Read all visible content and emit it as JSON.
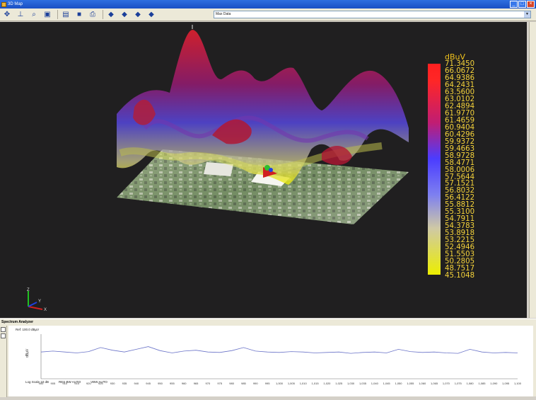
{
  "window": {
    "title": "3D Map",
    "min": "_",
    "max": "□",
    "close": "×"
  },
  "toolbar": {
    "buttons": [
      "move-icon",
      "axis-icon",
      "zoom-icon",
      "fit-icon",
      "export-icon",
      "save-icon",
      "print-icon",
      "view-front-icon",
      "view-top-icon",
      "view-iso-icon",
      "view-side-icon"
    ],
    "dropdown_value": "Max Data",
    "dropdown_arrow": "▼"
  },
  "legend": {
    "unit": "dBuV",
    "values": [
      "71.3450",
      "66.0672",
      "64.9386",
      "64.2431",
      "63.5600",
      "63.0102",
      "62.4894",
      "61.9770",
      "61.4659",
      "60.9404",
      "60.4296",
      "59.9372",
      "59.4663",
      "58.9728",
      "58.4771",
      "58.0006",
      "57.5644",
      "57.1521",
      "56.8032",
      "56.4122",
      "55.8812",
      "55.3100",
      "54.7911",
      "54.3783",
      "53.8918",
      "53.2215",
      "52.4946",
      "51.5503",
      "50.2805",
      "48.7517",
      "45.1048"
    ]
  },
  "axes": {
    "z": "Z",
    "y": "Y",
    "x": "X"
  },
  "spectrum": {
    "title": "Spectrum Analyzer",
    "ref_level": "Ref: 100.0 dBµV",
    "ylabel": "dBµV",
    "xticks": [
      "900",
      "905",
      "910",
      "915",
      "920",
      "925",
      "930",
      "935",
      "940",
      "945",
      "950",
      "955",
      "960",
      "965",
      "970",
      "975",
      "980",
      "985",
      "990",
      "995",
      "1,000",
      "1,005",
      "1,010",
      "1,015",
      "1,020",
      "1,025",
      "1,030",
      "1,035",
      "1,040",
      "1,045",
      "1,050",
      "1,055",
      "1,060",
      "1,065",
      "1,070",
      "1,075",
      "1,080",
      "1,085",
      "1,090",
      "1,095",
      "1,100"
    ],
    "status": [
      "Log Scale 10 dB",
      "RES BW AUTO",
      "VBW AUTO"
    ]
  },
  "chart_data": {
    "type": "line",
    "title": "",
    "xlabel": "",
    "ylabel": "dBµV",
    "x": [
      900,
      905,
      910,
      915,
      920,
      925,
      930,
      935,
      940,
      945,
      950,
      955,
      960,
      965,
      970,
      975,
      980,
      985,
      990,
      995,
      1000,
      1005,
      1010,
      1015,
      1020,
      1025,
      1030,
      1035,
      1040,
      1045,
      1050,
      1055,
      1060,
      1065,
      1070,
      1075,
      1080,
      1085,
      1090,
      1095,
      1100
    ],
    "series": [
      {
        "values": [
          60,
          62,
          60,
          58,
          61,
          70,
          64,
          60,
          66,
          72,
          63,
          58,
          62,
          64,
          60,
          59,
          63,
          70,
          62,
          60,
          59,
          61,
          60,
          58,
          59,
          60,
          57,
          59,
          60,
          58,
          66,
          61,
          59,
          60,
          58,
          57,
          66,
          60,
          58,
          59,
          58
        ]
      }
    ],
    "xlim": [
      900,
      1100
    ],
    "ylim": [
      0,
      100
    ],
    "grid": false,
    "colors": {
      "line": "#6a73c8"
    }
  }
}
